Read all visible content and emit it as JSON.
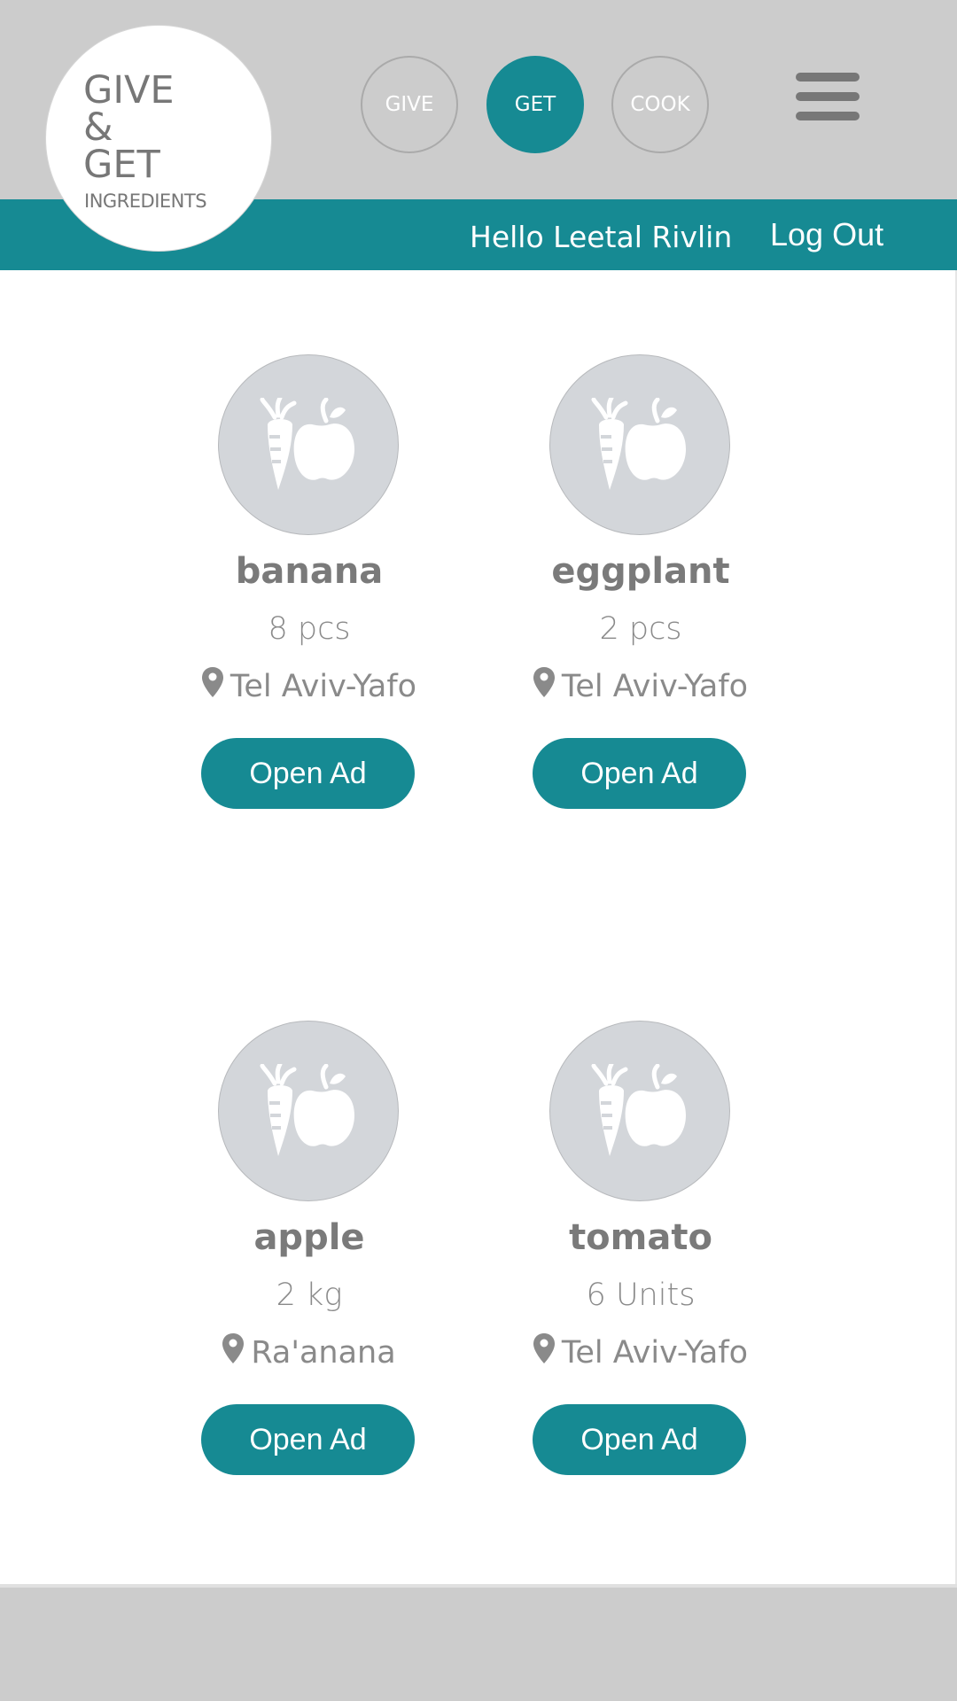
{
  "logo": {
    "line1": "GIVE",
    "line2": "&",
    "line3": "GET",
    "line4": "INGREDIENTS"
  },
  "nav": {
    "give": "GIVE",
    "get": "GET",
    "cook": "COOK",
    "active": "GET"
  },
  "user_bar": {
    "greeting": "Hello Leetal Rivlin",
    "logout": "Log Out"
  },
  "listings": [
    {
      "name": "banana",
      "quantity": "8 pcs",
      "location": "Tel Aviv-Yafo",
      "button": "Open Ad",
      "icon": "produce-icon"
    },
    {
      "name": "eggplant",
      "quantity": "2 pcs",
      "location": "Tel Aviv-Yafo",
      "button": "Open Ad",
      "icon": "produce-icon"
    },
    {
      "name": "apple",
      "quantity": "2 kg",
      "location": "Ra'anana",
      "button": "Open Ad",
      "icon": "produce-icon"
    },
    {
      "name": "tomato",
      "quantity": "6 Units",
      "location": "Tel Aviv-Yafo",
      "button": "Open Ad",
      "icon": "produce-icon"
    }
  ],
  "colors": {
    "accent": "#168a93",
    "header_gray": "#cccccc",
    "text_gray": "#7a7a7a",
    "placeholder_circle": "#d3d6da"
  }
}
